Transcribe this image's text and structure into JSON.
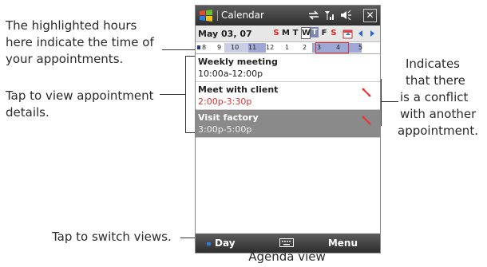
{
  "callouts": {
    "hours": [
      "The highlighted hours",
      "here indicate the time of",
      "your appointments."
    ],
    "details": [
      "Tap to view appointment",
      "details."
    ],
    "conflict": [
      "Indicates",
      "that there",
      "is a conflict",
      "with another",
      "appointment."
    ],
    "switch": "Tap to switch views."
  },
  "titlebar": {
    "title": "Calendar"
  },
  "datebar": {
    "date": "May 03, 07",
    "days": [
      "S",
      "M",
      "T",
      "W",
      "T",
      "F",
      "S"
    ]
  },
  "hours": [
    "8",
    "9",
    "10",
    "11",
    "12",
    "1",
    "2",
    "3",
    "4",
    "5"
  ],
  "appointments": [
    {
      "subject": "Weekly meeting",
      "time": "10:00a-12:00p"
    },
    {
      "subject": "Meet with client",
      "time": "2:00p-3:30p"
    },
    {
      "subject": "Visit factory",
      "time": "3:00p-5:00p"
    }
  ],
  "softkeys": {
    "left": "Day",
    "right": "Menu"
  },
  "caption": "Agenda view",
  "colors": {
    "highlight": "#9fa7d4",
    "conflict": "#e03030",
    "selected": "#8a8a8a"
  },
  "icons": [
    "windows-flag-icon",
    "sync-icon",
    "signal-icon",
    "volume-icon",
    "close-icon",
    "go-to-today-icon",
    "arrow-left-icon",
    "arrow-right-icon",
    "conflict-icon",
    "keyboard-icon"
  ]
}
